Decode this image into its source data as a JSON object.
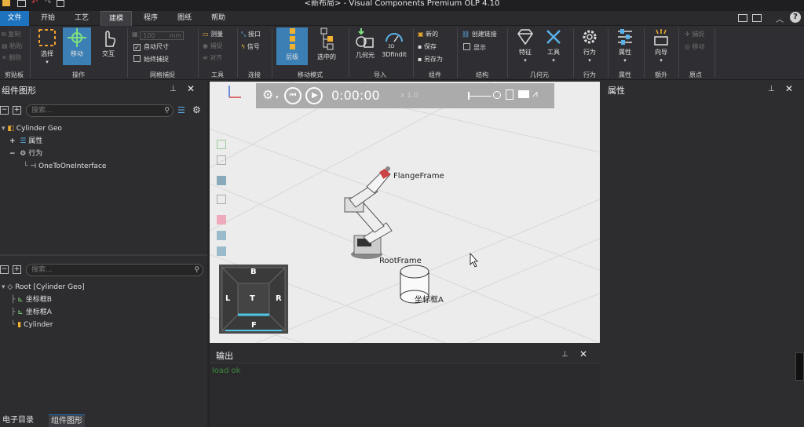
{
  "window": {
    "title": "<新布局> - Visual Components Premium OLP 4.10"
  },
  "tabs": [
    "文件",
    "开始",
    "工艺",
    "建模",
    "程序",
    "图纸",
    "帮助"
  ],
  "ribbon": {
    "clipboard": {
      "label": "剪贴板",
      "copy": "复制",
      "paste": "粘贴",
      "delete": "删除"
    },
    "operate": {
      "label": "操作",
      "select": "选择",
      "move": "移动",
      "interact": "交互"
    },
    "grid": {
      "label": "网格捕捉",
      "size_value": "100",
      "size_unit": "mm",
      "auto_size": "自动尺寸",
      "always_snap": "始终捕捉"
    },
    "tools": {
      "label": "工具",
      "measure": "测量",
      "snap": "捕捉",
      "align": "对齐"
    },
    "connect": {
      "label": "连接",
      "interface": "接口",
      "signal": "信号"
    },
    "move_mode": {
      "label": "移动模式",
      "hierarchy": "层级",
      "selected": "选中的"
    },
    "import": {
      "label": "导入",
      "geometry": "几何元",
      "finder": "3Dfindit"
    },
    "component": {
      "label": "组件",
      "new": "新的",
      "save": "保存",
      "save_as": "另存为"
    },
    "structure": {
      "label": "结构",
      "create_link": "创建链接",
      "show": "显示"
    },
    "geometry_grp": {
      "label": "几何元",
      "feature": "特征",
      "tool": "工具"
    },
    "behavior": {
      "label": "行为",
      "btn": "行为"
    },
    "properties": {
      "label": "属性",
      "btn": "属性"
    },
    "extra": {
      "label": "额外",
      "wizard": "向导"
    },
    "origin": {
      "label": "原点",
      "snap": "捕捉",
      "move": "移动"
    }
  },
  "left_panel": {
    "title": "组件图形",
    "search_placeholder": "搜索...",
    "tree": {
      "root": "Cylinder Geo",
      "properties": "属性",
      "behaviors": "行为",
      "behavior_item": "OneToOneInterface"
    }
  },
  "left_panel_lower": {
    "search_placeholder": "搜索...",
    "tree": {
      "root": "Root [Cylinder Geo]",
      "frame_b": "坐标框B",
      "frame_a": "坐标框A",
      "cylinder": "Cylinder"
    }
  },
  "viewport": {
    "time": "0:00:00",
    "speed": "x 1.0",
    "labels": {
      "flange": "FlangeFrame",
      "root": "RootFrame",
      "frame": "坐标框A"
    },
    "navcube": {
      "top": "B",
      "left": "L",
      "center": "T",
      "right": "R",
      "bottom": "F"
    }
  },
  "output": {
    "title": "输出",
    "message": "load ok"
  },
  "right_panel": {
    "title": "属性"
  },
  "bottom_tabs": [
    "电子目录",
    "组件图形"
  ],
  "colors": {
    "accent": "#1e73be",
    "selected_btn": "#3b7fb5",
    "output_text": "#3d8a3d",
    "navcube_highlight": "#4ec8e6"
  }
}
